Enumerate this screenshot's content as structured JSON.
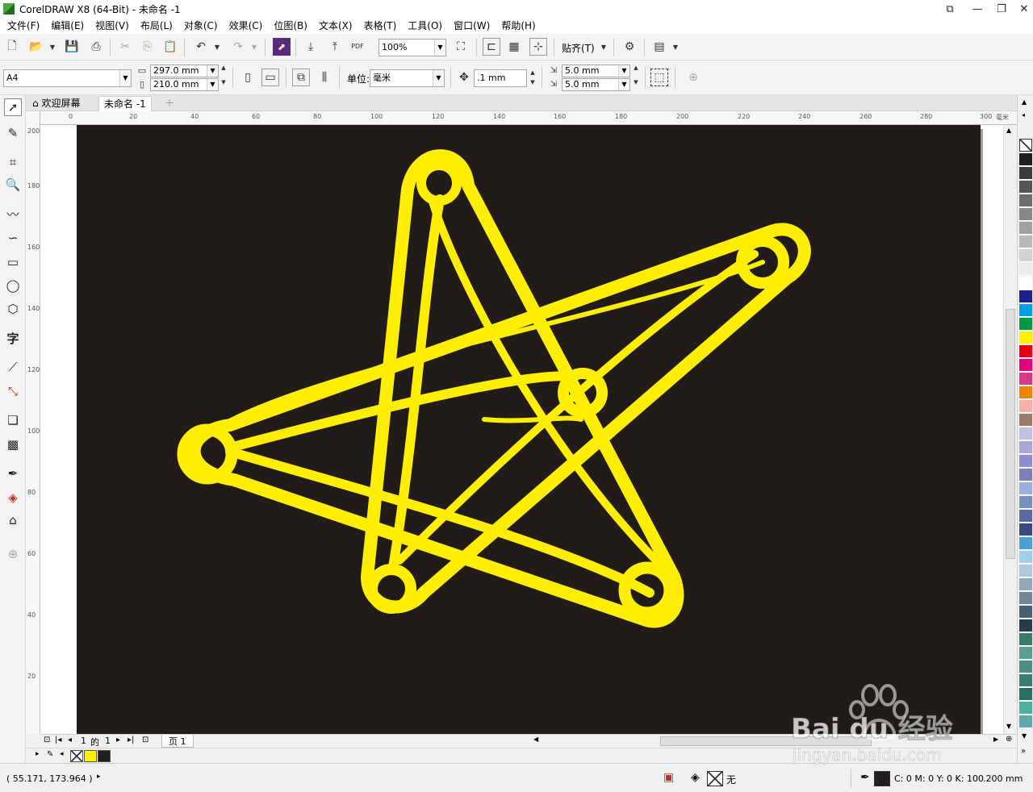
{
  "window": {
    "title": "CorelDRAW X8 (64-Bit) - 未命名 -1"
  },
  "menu": [
    "文件(F)",
    "编辑(E)",
    "视图(V)",
    "布局(L)",
    "对象(C)",
    "效果(C)",
    "位图(B)",
    "文本(X)",
    "表格(T)",
    "工具(O)",
    "窗口(W)",
    "帮助(H)"
  ],
  "standard": {
    "zoom": "100%",
    "snap_label": "贴齐(T)",
    "pdf_label": "PDF"
  },
  "property": {
    "paper": "A4",
    "width": "297.0 mm",
    "height": "210.0 mm",
    "unit_label": "单位:",
    "unit": "毫米",
    "nudge": ".1 mm",
    "dup_x": "5.0 mm",
    "dup_y": "5.0 mm"
  },
  "tabs": {
    "welcome": "欢迎屏幕",
    "doc": "未命名 -1"
  },
  "ruler": {
    "h_ticks": [
      "0",
      "20",
      "40",
      "60",
      "80",
      "100",
      "120",
      "140",
      "160",
      "180",
      "200",
      "220",
      "240",
      "260",
      "280",
      "300"
    ],
    "h_unit": "毫米",
    "v_ticks": [
      "200",
      "180",
      "160",
      "140",
      "120",
      "100",
      "80",
      "60",
      "40",
      "20"
    ]
  },
  "pagenav": {
    "current": "1",
    "of": "的",
    "total": "1",
    "page_tab": "页 1"
  },
  "status": {
    "coords": "( 55.171, 173.964 )",
    "fill_none": "无",
    "color_info": "C: 0 M: 0 Y: 0 K: 100",
    "outline_width": ".200 mm"
  },
  "colors": {
    "canvas": "#211c18",
    "star": "#ffee00",
    "palette": [
      "#231f20",
      "#3c3c3c",
      "#555555",
      "#6e6e6e",
      "#878787",
      "#a0a0a0",
      "#b9b9b9",
      "#d2d2d2",
      "#ebebeb",
      "#ffffff",
      "#1d2088",
      "#00a0e9",
      "#009944",
      "#fff100",
      "#e60012",
      "#e4007f",
      "#d23b8b",
      "#f08300",
      "#f5b1aa",
      "#a0796a",
      "#c0c0e0",
      "#a8a8d8",
      "#8f8fd0",
      "#7f7fb8",
      "#9ab0d8",
      "#7a90c0",
      "#5a6aa0",
      "#3a4a80",
      "#4aa0d8",
      "#a0d0f0",
      "#b0c8d8",
      "#90a8b8",
      "#70889a",
      "#4a6070",
      "#2a3a4a",
      "#3a7a6a",
      "#5aa090",
      "#4a9080",
      "#3a8070",
      "#2a7060",
      "#50b0a0",
      "#60a8b0"
    ]
  },
  "watermark": {
    "brand": "Bai du 经验",
    "url": "jingyan.baidu.com"
  }
}
